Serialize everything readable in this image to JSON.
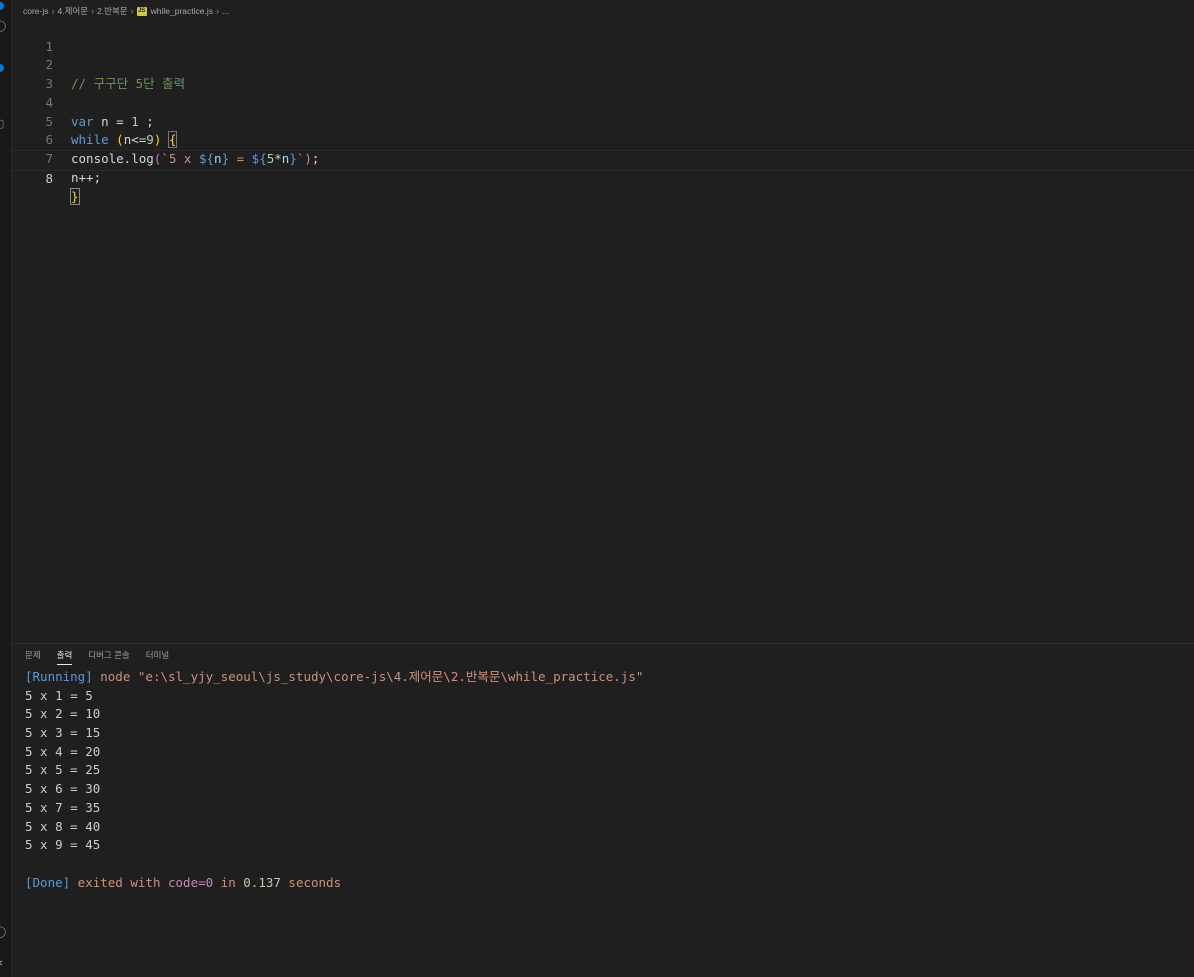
{
  "breadcrumb": {
    "items": [
      "core-js",
      "4.제어문",
      "2.반복문"
    ],
    "file": "while_practice.js",
    "tail": "..."
  },
  "editor": {
    "line_numbers": [
      "1",
      "2",
      "3",
      "4",
      "5",
      "6",
      "7",
      "8"
    ],
    "lines": {
      "l2_comment": "// 구구단 5단 출력",
      "l4_kw": "var",
      "l4_rest": " n = ",
      "l4_num": "1",
      "l4_end": " ;",
      "l5_kw": "while",
      "l5_sp": " ",
      "l5_open": "(",
      "l5_mid": "n<=",
      "l5_num": "9",
      "l5_close": ")",
      "l5_sp2": " ",
      "l5_brace": "{",
      "l6_a": "console.log",
      "l6_paren": "(",
      "l6_str1": "`5 x ",
      "l6_t1": "${",
      "l6_v1": "n",
      "l6_t1c": "}",
      "l6_str2": " = ",
      "l6_t2": "${",
      "l6_num": "5",
      "l6_op": "*",
      "l6_v2": "n",
      "l6_t2c": "}",
      "l6_str3": "`",
      "l6_pclose": ")",
      "l6_end": ";",
      "l7": "n++;",
      "l8": "}"
    }
  },
  "panel": {
    "tabs": [
      "문제",
      "출력",
      "디버그 콘솔",
      "터미널"
    ],
    "active_tab": "출력",
    "running_tag": "[Running]",
    "running_cmd": " node \"e:\\sl_yjy_seoul\\js_study\\core-js\\4.제어문\\2.반복문\\while_practice.js\"",
    "results": [
      "5 x 1 = 5",
      "5 x 2 = 10",
      "5 x 3 = 15",
      "5 x 4 = 20",
      "5 x 5 = 25",
      "5 x 6 = 30",
      "5 x 7 = 35",
      "5 x 8 = 40",
      "5 x 9 = 45"
    ],
    "done_tag": "[Done]",
    "done_text": " exited with ",
    "done_code": "code=0",
    "done_in": " in ",
    "done_time": "0.137",
    "done_seconds": " seconds"
  }
}
